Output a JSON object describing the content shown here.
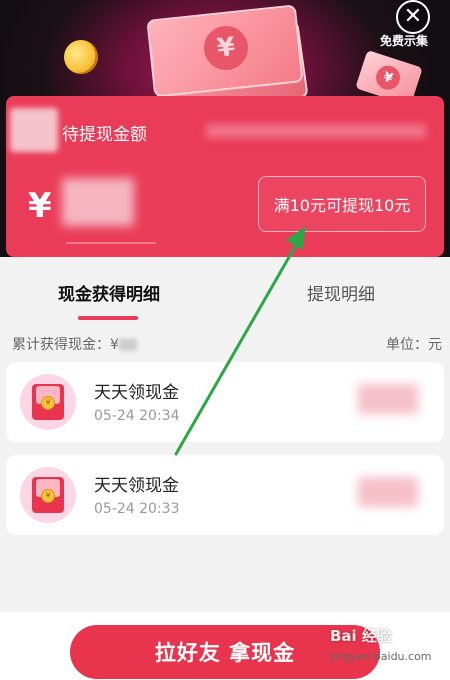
{
  "header": {
    "close_icon": "close-icon",
    "corner_text": "免费示集"
  },
  "card": {
    "title": "待提现金额",
    "currency_symbol": "¥",
    "withdraw_button": "满10元可提现10元"
  },
  "tabs": [
    {
      "label": "现金获得明细",
      "active": true
    },
    {
      "label": "提现明细",
      "active": false
    }
  ],
  "summary": {
    "label": "累计获得现金：¥",
    "unit": "单位：元"
  },
  "items": [
    {
      "title": "天天领现金",
      "time": "05-24 20:34",
      "icon": "red-envelope-icon"
    },
    {
      "title": "天天领现金",
      "time": "05-24 20:33",
      "icon": "red-envelope-icon"
    }
  ],
  "footer": {
    "invite_button": "拉好友 拿现金",
    "watermark": "Bai 经验",
    "watermark_sub": "jingyan.baidu.com"
  },
  "colors": {
    "accent": "#ea3c59",
    "annotation_arrow": "#2aa845"
  }
}
